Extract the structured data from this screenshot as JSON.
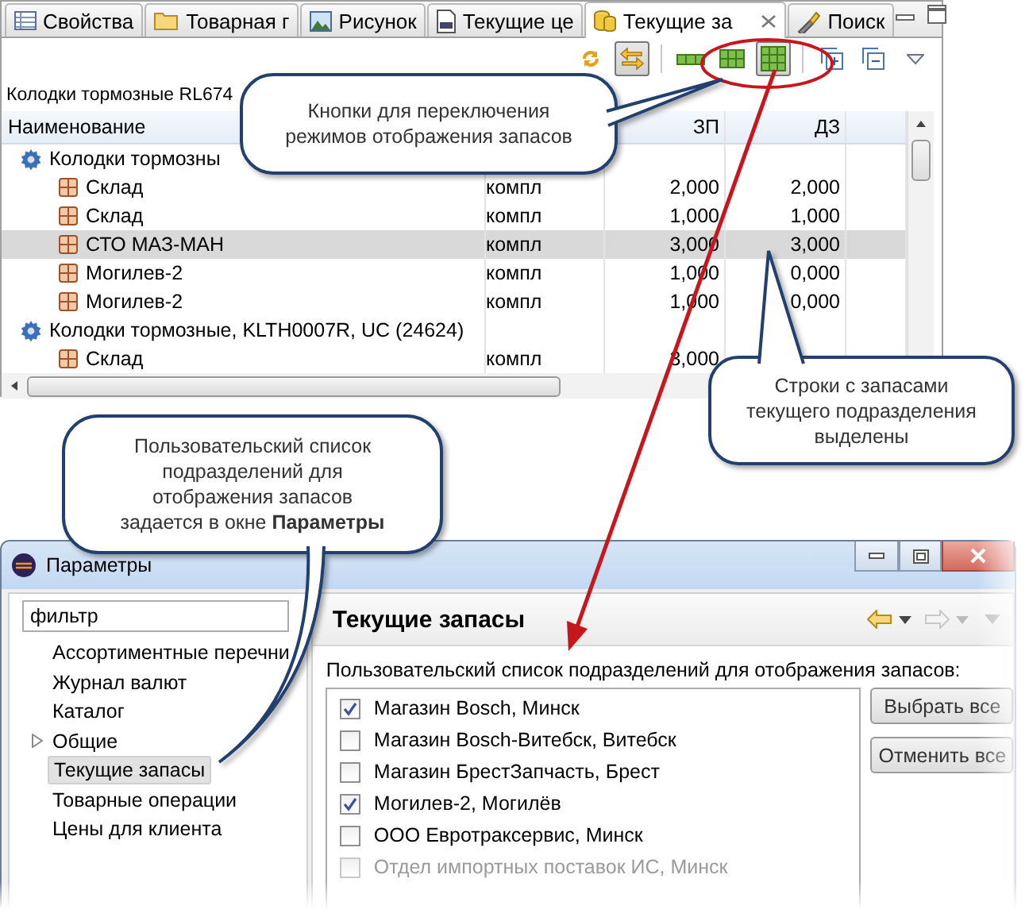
{
  "panel": {
    "tabs": [
      {
        "label": "Свойства",
        "selected": false
      },
      {
        "label": "Товарная г",
        "selected": false
      },
      {
        "label": "Рисунок",
        "selected": false
      },
      {
        "label": "Текущие це",
        "selected": false
      },
      {
        "label": "Текущие за",
        "selected": true
      },
      {
        "label": "Поиск",
        "selected": false
      }
    ],
    "toolbar": [
      {
        "kind": "sync",
        "pressed": false
      },
      {
        "kind": "link",
        "pressed": true
      },
      {
        "kind": "mode1",
        "pressed": false
      },
      {
        "kind": "mode2",
        "pressed": false
      },
      {
        "kind": "mode3",
        "pressed": true
      },
      {
        "kind": "expand",
        "pressed": false
      },
      {
        "kind": "collapse",
        "pressed": false
      },
      {
        "kind": "menu",
        "pressed": false
      }
    ],
    "title": "Колодки тормозные RL674",
    "columns": [
      {
        "label": "Наименование"
      },
      {
        "label": "ЗП"
      },
      {
        "label": "ДЗ"
      }
    ],
    "rows": [
      {
        "kind": "item",
        "name": "Колодки тормозны",
        "selected": false
      },
      {
        "kind": "store",
        "name": "Склад",
        "unit": "компл",
        "zp": "2,000",
        "dz": "2,000",
        "selected": false
      },
      {
        "kind": "store",
        "name": "Склад",
        "unit": "компл",
        "zp": "1,000",
        "dz": "1,000",
        "selected": false
      },
      {
        "kind": "store",
        "name": "СТО МАЗ-МАН",
        "unit": "компл",
        "zp": "3,000",
        "dz": "3,000",
        "selected": true
      },
      {
        "kind": "store",
        "name": "Могилев-2",
        "unit": "компл",
        "zp": "1,000",
        "dz": "0,000",
        "selected": false
      },
      {
        "kind": "store",
        "name": "Могилев-2",
        "unit": "компл",
        "zp": "1,000",
        "dz": "0,000",
        "selected": false
      },
      {
        "kind": "item",
        "name": "Колодки тормозные, KLTH0007R, UC (24624)",
        "selected": false
      },
      {
        "kind": "store",
        "name": "Склад",
        "unit": "компл",
        "zp": "3,000",
        "selected": false
      }
    ]
  },
  "callouts": [
    {
      "text": "Кнопки для переключения режимов отображения запасов"
    },
    {
      "text": "Строки с запасами текущего подразделения выделены"
    },
    {
      "text": "Пользовательский список подразделений для отображения запасов задается в окне **Параметры**"
    }
  ],
  "dialog": {
    "title": "Параметры",
    "filter": "фильтр",
    "tree": [
      {
        "label": "Ассортиментные перечни",
        "kind": "leaf",
        "selected": false
      },
      {
        "label": "Журнал валют",
        "kind": "leaf",
        "selected": false
      },
      {
        "label": "Каталог",
        "kind": "leaf",
        "selected": false
      },
      {
        "label": "Общие",
        "kind": "folder",
        "selected": false
      },
      {
        "label": "Текущие запасы",
        "kind": "leaf",
        "selected": true
      },
      {
        "label": "Товарные операции",
        "kind": "leaf",
        "selected": false
      },
      {
        "label": "Цены для клиента",
        "kind": "leaf",
        "selected": false
      }
    ],
    "page_title": "Текущие запасы",
    "list_label": "Пользовательский список подразделений для отображения запасов:",
    "units": [
      {
        "label": "Магазин Bosch, Минск",
        "checked": true,
        "disabled": false
      },
      {
        "label": "Магазин Bosch-Витебск, Витебск",
        "checked": false,
        "disabled": false
      },
      {
        "label": "Магазин БрестЗапчасть, Брест",
        "checked": false,
        "disabled": false
      },
      {
        "label": "Могилев-2, Могилёв",
        "checked": true,
        "disabled": false
      },
      {
        "label": "ООО Евротраксервис, Минск",
        "checked": false,
        "disabled": false
      },
      {
        "label": "Отдел импортных поставок ИС, Минск",
        "checked": false,
        "disabled": true
      }
    ],
    "buttons": [
      {
        "label": "Выбрать все"
      },
      {
        "label": "Отменить все"
      }
    ]
  }
}
